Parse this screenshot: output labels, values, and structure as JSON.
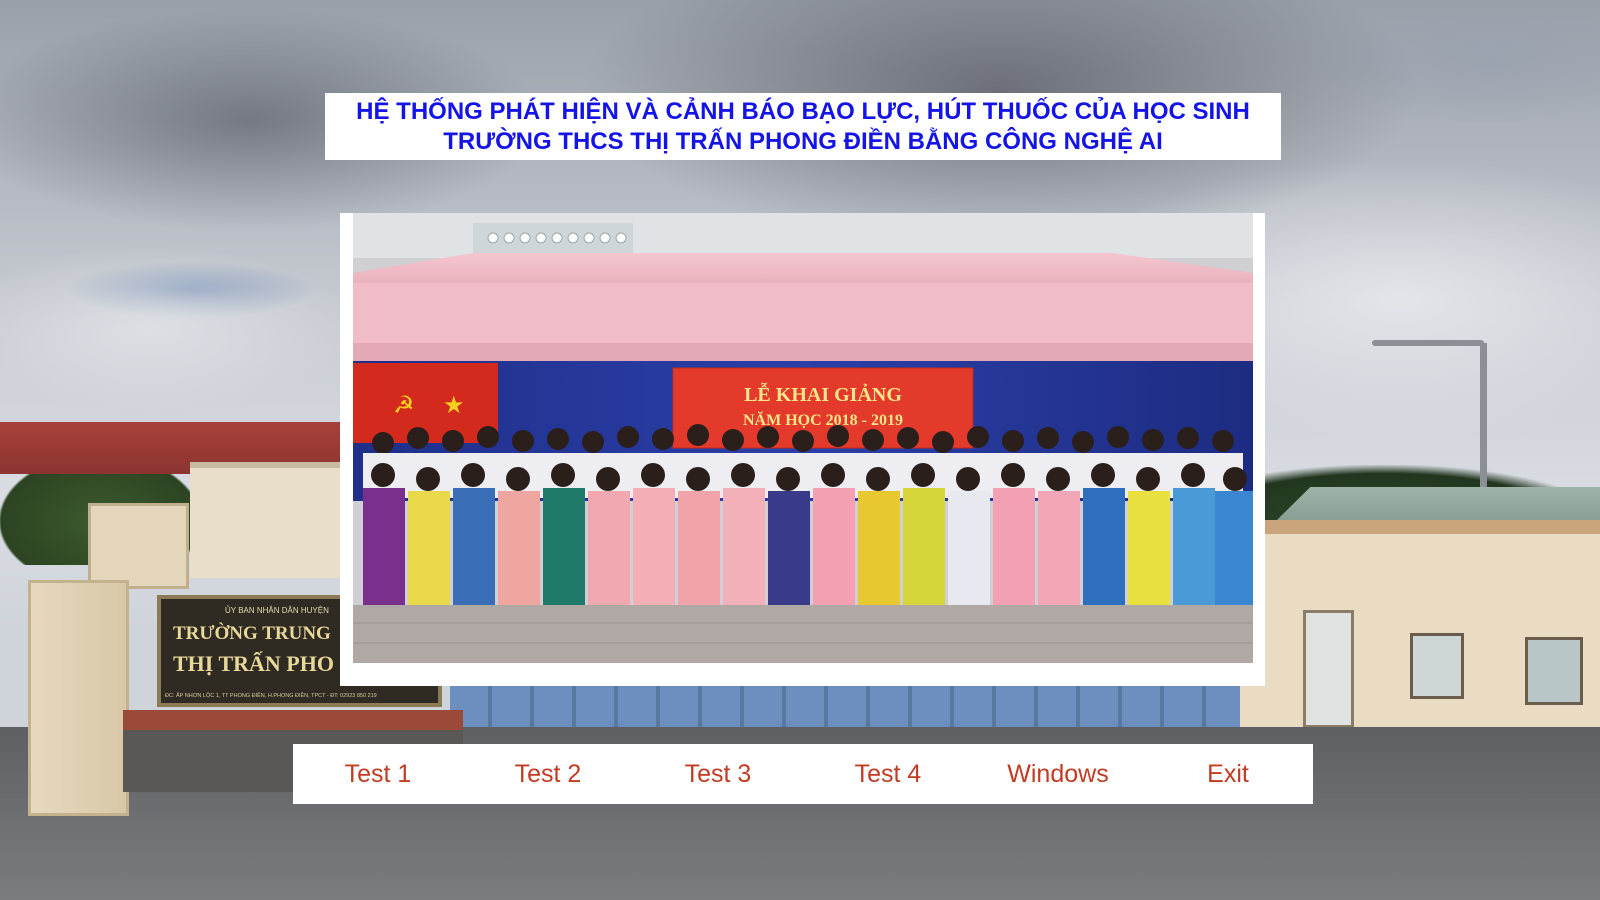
{
  "title": {
    "line1": "HỆ THỐNG PHÁT HIỆN VÀ CẢNH BÁO BẠO LỰC, HÚT THUỐC CỦA HỌC SINH",
    "line2": "TRƯỜNG THCS THỊ TRẤN PHONG ĐIỀN BẰNG CÔNG NGHỆ AI",
    "color": "#1414e6"
  },
  "photo": {
    "banner_line1": "LỄ KHAI GIẢNG",
    "banner_line2": "NĂM HỌC 2018 - 2019"
  },
  "background": {
    "sign_line1": "ỦY BAN NHÂN DÂN HUYỆN",
    "sign_line2": "TRƯỜNG TRUNG",
    "sign_line3": "THỊ TRẤN PHO",
    "sign_line4": "ĐC: ẤP NHƠN LỘC 1, TT PHONG ĐIỀN, H.PHONG ĐIỀN, TPCT - ĐT: 02923 850 219"
  },
  "menu": {
    "color": "#c23b22",
    "items": [
      {
        "label": "Test 1"
      },
      {
        "label": "Test 2"
      },
      {
        "label": "Test 3"
      },
      {
        "label": "Test 4"
      },
      {
        "label": "Windows"
      },
      {
        "label": "Exit"
      }
    ]
  }
}
